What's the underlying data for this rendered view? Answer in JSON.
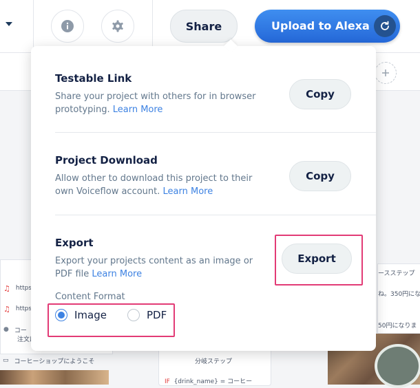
{
  "header": {
    "share_label": "Share",
    "upload_label": "Upload to Alexa"
  },
  "popover": {
    "testable_link": {
      "title": "Testable Link",
      "description": "Share your project with others for in browser prototyping.",
      "learn_more": "Learn More",
      "button": "Copy"
    },
    "project_download": {
      "title": "Project Download",
      "description": "Allow other to download this project to their own Voiceflow account.",
      "learn_more": "Learn More",
      "button": "Copy"
    },
    "export": {
      "title": "Export",
      "description": "Export your projects content as an image or PDF file",
      "learn_more": "Learn More",
      "button": "Export"
    },
    "content_format": {
      "label": "Content Format",
      "options": [
        "Image",
        "PDF"
      ],
      "selected": "Image"
    }
  },
  "background": {
    "row1": "https",
    "row2": "https",
    "row3a": "コー",
    "row3b": "注文は",
    "row4": "コーヒーショップにようこそ",
    "flow_title": "分岐ステップ",
    "flow_if": "IF",
    "flow_cond": "{drink_name} = コーヒー",
    "right1": "ースステップ",
    "right2": "ね。350円になり",
    "right3": "50円になりま"
  },
  "colors": {
    "accent": "#3d82e2",
    "highlight": "#e23a75"
  }
}
